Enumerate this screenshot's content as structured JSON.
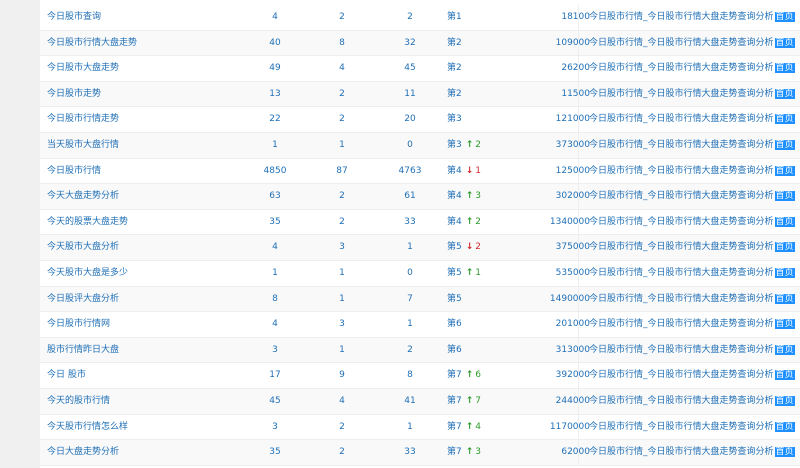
{
  "title_text": "今日股市行情_今日股市行情大盘走势查询分析",
  "home_label": "首页",
  "colors": {
    "link": "#1f6fb6",
    "up": "#2e9b2e",
    "down": "#d22b2b",
    "badge": "#1e90ff"
  },
  "rows": [
    {
      "kw": "今日股市查询",
      "a": "4",
      "b": "2",
      "c": "2",
      "rank": "第1",
      "dir": "",
      "chg": "",
      "vol": "18100"
    },
    {
      "kw": "今日股市行情大盘走势",
      "a": "40",
      "b": "8",
      "c": "32",
      "rank": "第2",
      "dir": "",
      "chg": "",
      "vol": "109000"
    },
    {
      "kw": "今日股市大盘走势",
      "a": "49",
      "b": "4",
      "c": "45",
      "rank": "第2",
      "dir": "",
      "chg": "",
      "vol": "26200"
    },
    {
      "kw": "今日股市走势",
      "a": "13",
      "b": "2",
      "c": "11",
      "rank": "第2",
      "dir": "",
      "chg": "",
      "vol": "11500"
    },
    {
      "kw": "今日股市行情走势",
      "a": "22",
      "b": "2",
      "c": "20",
      "rank": "第3",
      "dir": "",
      "chg": "",
      "vol": "121000"
    },
    {
      "kw": "当天股市大盘行情",
      "a": "1",
      "b": "1",
      "c": "0",
      "rank": "第3",
      "dir": "up",
      "chg": "2",
      "vol": "373000"
    },
    {
      "kw": "今日股市行情",
      "a": "4850",
      "b": "87",
      "c": "4763",
      "rank": "第4",
      "dir": "down",
      "chg": "1",
      "vol": "125000"
    },
    {
      "kw": "今天大盘走势分析",
      "a": "63",
      "b": "2",
      "c": "61",
      "rank": "第4",
      "dir": "up",
      "chg": "3",
      "vol": "302000"
    },
    {
      "kw": "今天的股票大盘走势",
      "a": "35",
      "b": "2",
      "c": "33",
      "rank": "第4",
      "dir": "up",
      "chg": "2",
      "vol": "1340000"
    },
    {
      "kw": "今天股市大盘分析",
      "a": "4",
      "b": "3",
      "c": "1",
      "rank": "第5",
      "dir": "down",
      "chg": "2",
      "vol": "375000"
    },
    {
      "kw": "今天股市大盘是多少",
      "a": "1",
      "b": "1",
      "c": "0",
      "rank": "第5",
      "dir": "up",
      "chg": "1",
      "vol": "535000"
    },
    {
      "kw": "今日股评大盘分析",
      "a": "8",
      "b": "1",
      "c": "7",
      "rank": "第5",
      "dir": "",
      "chg": "",
      "vol": "1490000"
    },
    {
      "kw": "今日股市行情网",
      "a": "4",
      "b": "3",
      "c": "1",
      "rank": "第6",
      "dir": "",
      "chg": "",
      "vol": "201000"
    },
    {
      "kw": "股市行情昨日大盘",
      "a": "3",
      "b": "1",
      "c": "2",
      "rank": "第6",
      "dir": "",
      "chg": "",
      "vol": "313000"
    },
    {
      "kw": "今日 股市",
      "a": "17",
      "b": "9",
      "c": "8",
      "rank": "第7",
      "dir": "up",
      "chg": "6",
      "vol": "392000"
    },
    {
      "kw": "今天的股市行情",
      "a": "45",
      "b": "4",
      "c": "41",
      "rank": "第7",
      "dir": "up",
      "chg": "7",
      "vol": "244000"
    },
    {
      "kw": "今天股市行情怎么样",
      "a": "3",
      "b": "2",
      "c": "1",
      "rank": "第7",
      "dir": "up",
      "chg": "4",
      "vol": "1170000"
    },
    {
      "kw": "今日大盘走势分析",
      "a": "35",
      "b": "2",
      "c": "33",
      "rank": "第7",
      "dir": "up",
      "chg": "3",
      "vol": "62000"
    }
  ]
}
